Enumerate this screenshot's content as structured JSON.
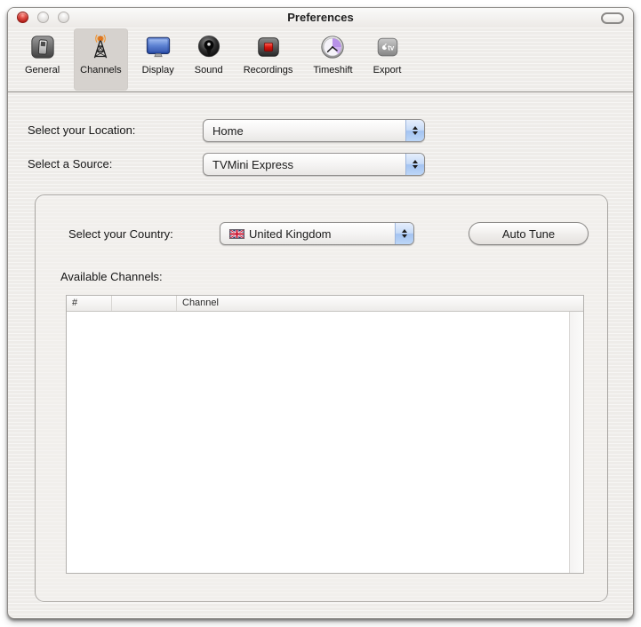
{
  "window": {
    "title": "Preferences"
  },
  "toolbar": {
    "items": [
      {
        "label": "General",
        "icon": "remote-control-icon",
        "selected": false
      },
      {
        "label": "Channels",
        "icon": "antenna-icon",
        "selected": true
      },
      {
        "label": "Display",
        "icon": "monitor-icon",
        "selected": false
      },
      {
        "label": "Sound",
        "icon": "speaker-icon",
        "selected": false
      },
      {
        "label": "Recordings",
        "icon": "record-icon",
        "selected": false
      },
      {
        "label": "Timeshift",
        "icon": "clock-icon",
        "selected": false
      },
      {
        "label": "Export",
        "icon": "appletv-icon",
        "icon_text": "tv",
        "selected": false
      }
    ]
  },
  "form": {
    "location": {
      "label": "Select your Location:",
      "value": "Home"
    },
    "source": {
      "label": "Select a Source:",
      "value": "TVMini Express"
    }
  },
  "tuning": {
    "country": {
      "label": "Select your Country:",
      "value": "United Kingdom",
      "flag": "uk-flag-icon"
    },
    "auto_tune_button": "Auto Tune",
    "channels": {
      "label": "Available Channels:",
      "columns": [
        "#",
        "",
        "Channel"
      ],
      "rows": []
    }
  },
  "colors": {
    "popup_cap_blue": "#b0ccf4",
    "selected_tab_bg": "#d6d2ce",
    "record_red": "#cc1712",
    "timeshift_purple": "#b892e8",
    "close_red": "#c52a22"
  }
}
